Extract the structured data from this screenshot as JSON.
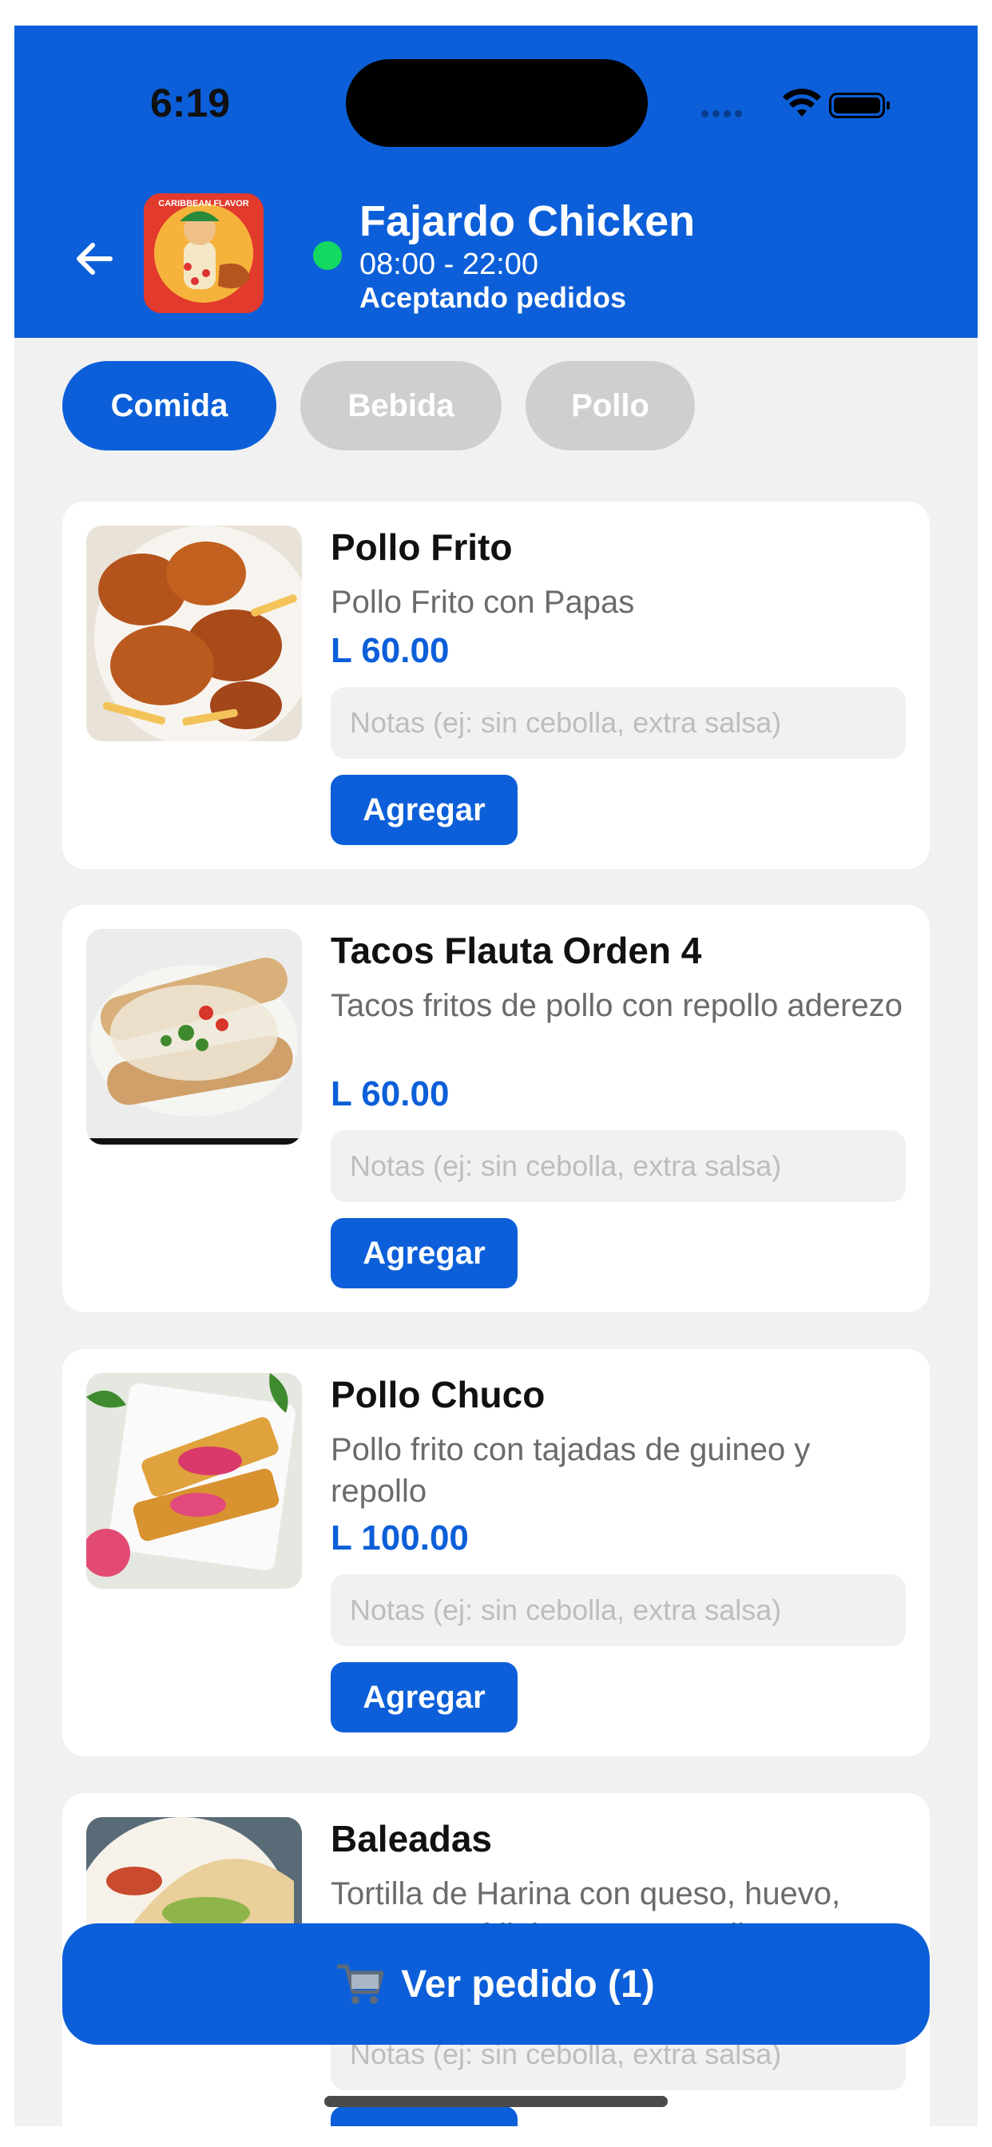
{
  "status_bar": {
    "time": "6:19"
  },
  "header": {
    "restaurant_name": "Fajardo Chicken",
    "hours": "08:00 - 22:00",
    "status": "Aceptando pedidos",
    "logo_text": "CARIBBEAN FLAVOR",
    "accent_color": "#0c5fd8",
    "online_color": "#14d960"
  },
  "tabs": [
    {
      "label": "Comida",
      "active": true
    },
    {
      "label": "Bebida",
      "active": false
    },
    {
      "label": "Pollo",
      "active": false
    }
  ],
  "menu_items": [
    {
      "name": "Pollo Frito",
      "description": "Pollo Frito con Papas",
      "price": "L 60.00",
      "notes_placeholder": "Notas (ej: sin cebolla, extra salsa)",
      "add_label": "Agregar"
    },
    {
      "name": "Tacos Flauta Orden 4",
      "description": "Tacos fritos de pollo con repollo aderezo",
      "price": "L 60.00",
      "notes_placeholder": "Notas (ej: sin cebolla, extra salsa)",
      "add_label": "Agregar"
    },
    {
      "name": "Pollo Chuco",
      "description": "Pollo frito con tajadas de guineo y repollo",
      "price": "L 100.00",
      "notes_placeholder": "Notas (ej: sin cebolla, extra salsa)",
      "add_label": "Agregar"
    },
    {
      "name": "Baleadas",
      "description": "Tortilla de Harina con queso, huevo, aguacate, frijoles y mantequilma",
      "notes_placeholder": "Notas (ej: sin cebolla, extra salsa)",
      "add_label": "Agregar"
    }
  ],
  "cart": {
    "label": "Ver pedido (1)",
    "icon": "shopping-cart-icon"
  }
}
